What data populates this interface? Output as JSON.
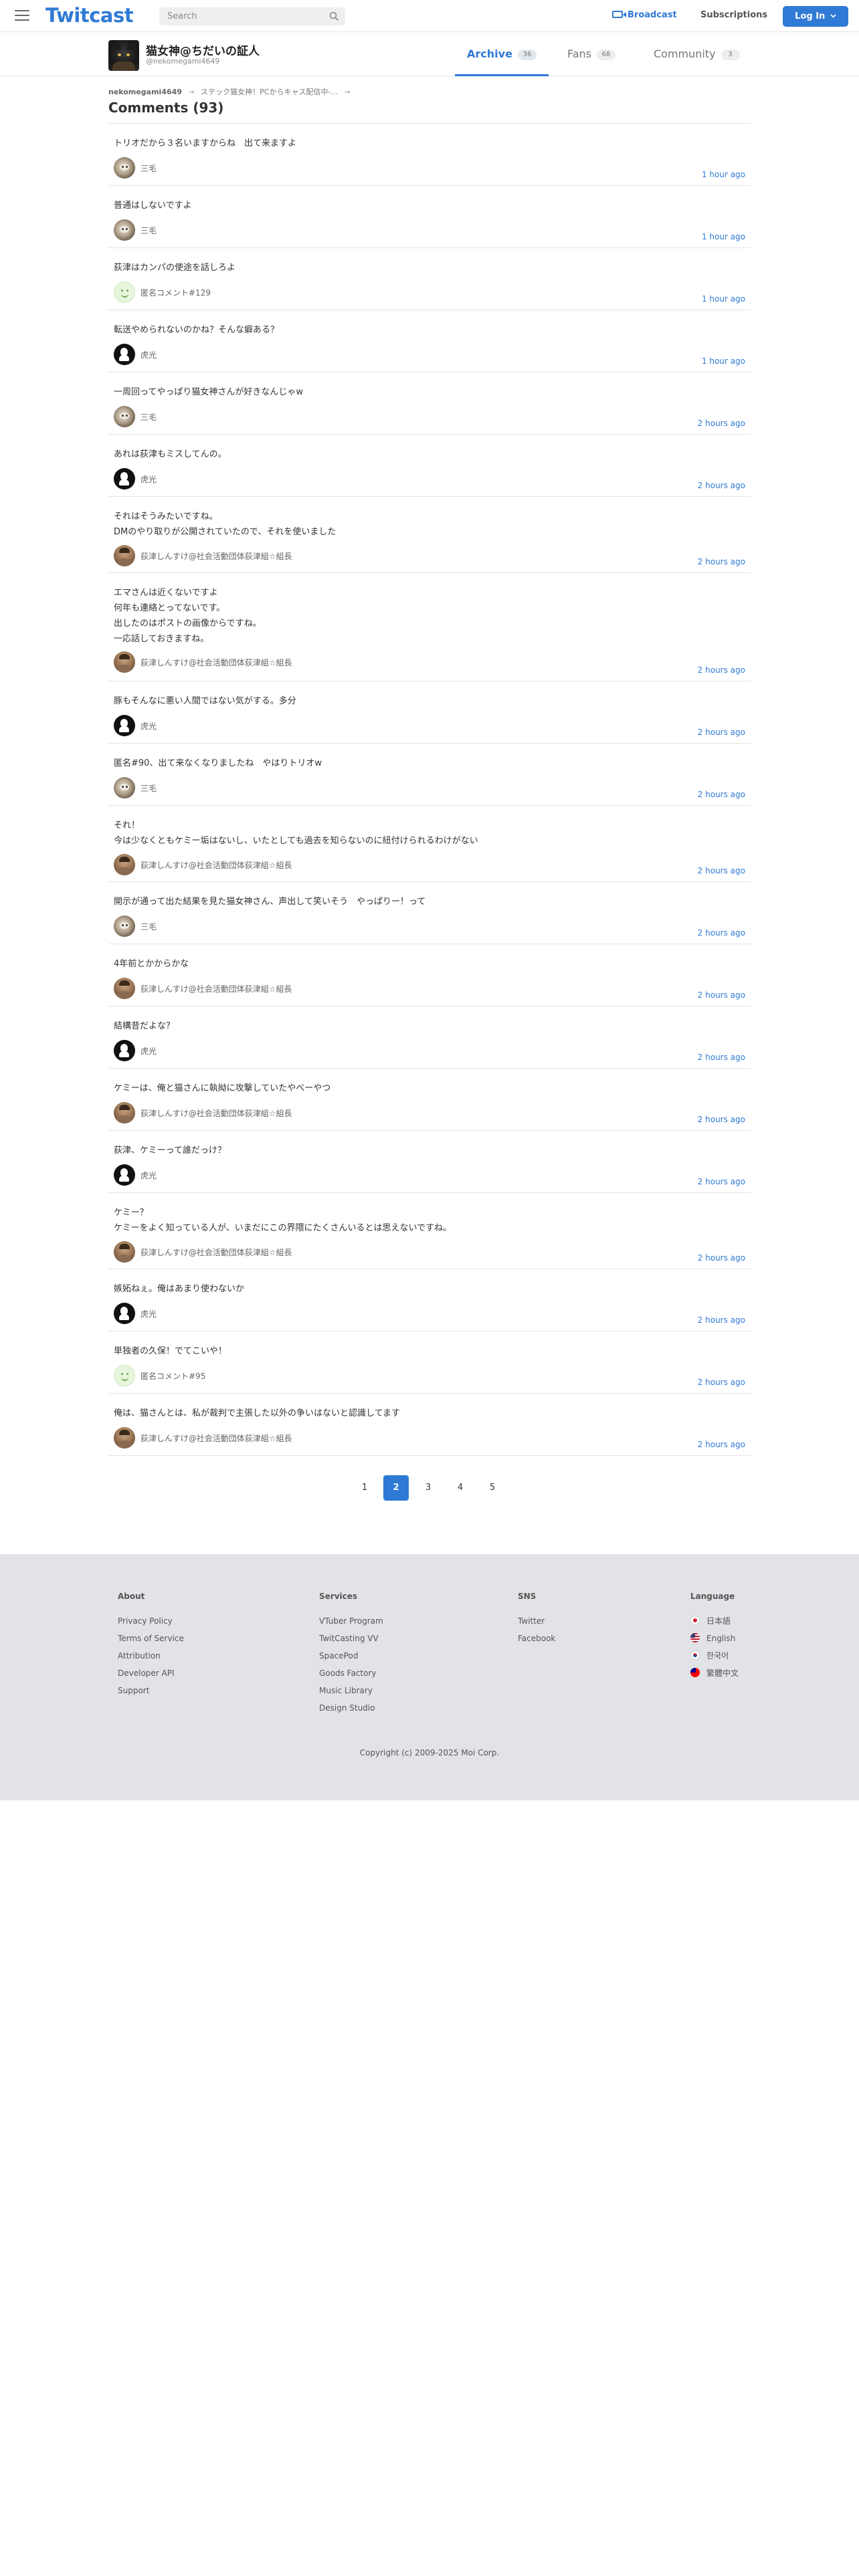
{
  "header": {
    "logo": "Twitcast",
    "search_placeholder": "Search",
    "broadcast_label": "Broadcast",
    "subscriptions_label": "Subscriptions",
    "login_label": "Log In",
    "accent_color": "#2f7ad5"
  },
  "user": {
    "name": "猫女神@ちだいの証人",
    "handle": "@nekomegami4649",
    "tabs": [
      {
        "label": "Archive",
        "count": "36",
        "active": true
      },
      {
        "label": "Fans",
        "count": "68",
        "active": false
      },
      {
        "label": "Community",
        "count": "3",
        "active": false
      }
    ]
  },
  "breadcrumb": {
    "user": "nekomegami4649",
    "movie": "ステック猫女神！PCからキャス配信中‐...",
    "sep": "→"
  },
  "page_title": "Comments (93)",
  "comments": [
    {
      "text": "トリオだから３名いますからね　出て来ますよ",
      "user": "三毛",
      "avatar": "cat",
      "time": "1 hour ago"
    },
    {
      "text": "普通はしないですよ",
      "user": "三毛",
      "avatar": "cat",
      "time": "1 hour ago"
    },
    {
      "text": "荻津はカンパの使途を話しろよ",
      "user": "匿名コメント#129",
      "avatar": "smile",
      "time": "1 hour ago"
    },
    {
      "text": "転送やめられないのかね？そんな癖ある？",
      "user": "虎光",
      "avatar": "tiger",
      "time": "1 hour ago"
    },
    {
      "text": "一周回ってやっぱり猫女神さんが好きなんじゃw",
      "user": "三毛",
      "avatar": "cat",
      "time": "2 hours ago"
    },
    {
      "text": "あれは荻津もミスしてんの。",
      "user": "虎光",
      "avatar": "tiger",
      "time": "2 hours ago"
    },
    {
      "text": "それはそうみたいですね。\nDMのやり取りが公開されていたので、それを使いました",
      "user": "荻津しんすけ@社会活動団体荻津組☆組長",
      "avatar": "person",
      "time": "2 hours ago"
    },
    {
      "text": "エマさんは近くないですよ\n何年も連絡とってないです。\n出したのはポストの画像からですね。\n一応話しておきますね。",
      "user": "荻津しんすけ@社会活動団体荻津組☆組長",
      "avatar": "person",
      "time": "2 hours ago"
    },
    {
      "text": "豚もそんなに悪い人間ではない気がする。多分",
      "user": "虎光",
      "avatar": "tiger",
      "time": "2 hours ago"
    },
    {
      "text": "匿名#90、出て来なくなりましたね　やはりトリオw",
      "user": "三毛",
      "avatar": "cat",
      "time": "2 hours ago"
    },
    {
      "text": "それ！\n今は少なくともケミー垢はないし、いたとしても過去を知らないのに紐付けられるわけがない",
      "user": "荻津しんすけ@社会活動団体荻津組☆組長",
      "avatar": "person",
      "time": "2 hours ago"
    },
    {
      "text": "開示が通って出た結果を見た猫女神さん、声出して笑いそう　やっぱりー！って",
      "user": "三毛",
      "avatar": "cat",
      "time": "2 hours ago"
    },
    {
      "text": "4年前とかからかな",
      "user": "荻津しんすけ@社会活動団体荻津組☆組長",
      "avatar": "person",
      "time": "2 hours ago"
    },
    {
      "text": "結構昔だよな？",
      "user": "虎光",
      "avatar": "tiger",
      "time": "2 hours ago"
    },
    {
      "text": "ケミーは、俺と猫さんに執拗に攻撃していたやべーやつ",
      "user": "荻津しんすけ@社会活動団体荻津組☆組長",
      "avatar": "person",
      "time": "2 hours ago"
    },
    {
      "text": "荻津、ケミーって誰だっけ？",
      "user": "虎光",
      "avatar": "tiger",
      "time": "2 hours ago"
    },
    {
      "text": "ケミー？\nケミーをよく知っている人が、いまだにこの界隈にたくさんいるとは思えないですね。",
      "user": "荻津しんすけ@社会活動団体荻津組☆組長",
      "avatar": "person",
      "time": "2 hours ago"
    },
    {
      "text": "嫉妬ねぇ。俺はあまり使わないか",
      "user": "虎光",
      "avatar": "tiger",
      "time": "2 hours ago"
    },
    {
      "text": "単独者の久保！でてこいや！",
      "user": "匿名コメント#95",
      "avatar": "smile",
      "time": "2 hours ago"
    },
    {
      "text": "俺は、猫さんとは、私が裁判で主張した以外の争いはないと認識してます",
      "user": "荻津しんすけ@社会活動団体荻津組☆組長",
      "avatar": "person",
      "time": "2 hours ago"
    }
  ],
  "pagination": {
    "pages": [
      "1",
      "2",
      "3",
      "4",
      "5"
    ],
    "current": "2"
  },
  "footer": {
    "about": {
      "title": "About",
      "items": [
        "Privacy Policy",
        "Terms of Service",
        "Attribution",
        "Developer API",
        "Support"
      ]
    },
    "services": {
      "title": "Services",
      "items": [
        "VTuber Program",
        "TwitCasting VV",
        "SpacePod",
        "Goods Factory",
        "Music Library",
        "Design Studio"
      ]
    },
    "sns": {
      "title": "SNS",
      "items": [
        "Twitter",
        "Facebook"
      ]
    },
    "language": {
      "title": "Language",
      "items": [
        {
          "label": "日本語",
          "flag": "jp"
        },
        {
          "label": "English",
          "flag": "us"
        },
        {
          "label": "한국어",
          "flag": "kr"
        },
        {
          "label": "繁體中文",
          "flag": "tw"
        }
      ]
    },
    "copyright": "Copyright (c) 2009-2025 Moi Corp."
  }
}
